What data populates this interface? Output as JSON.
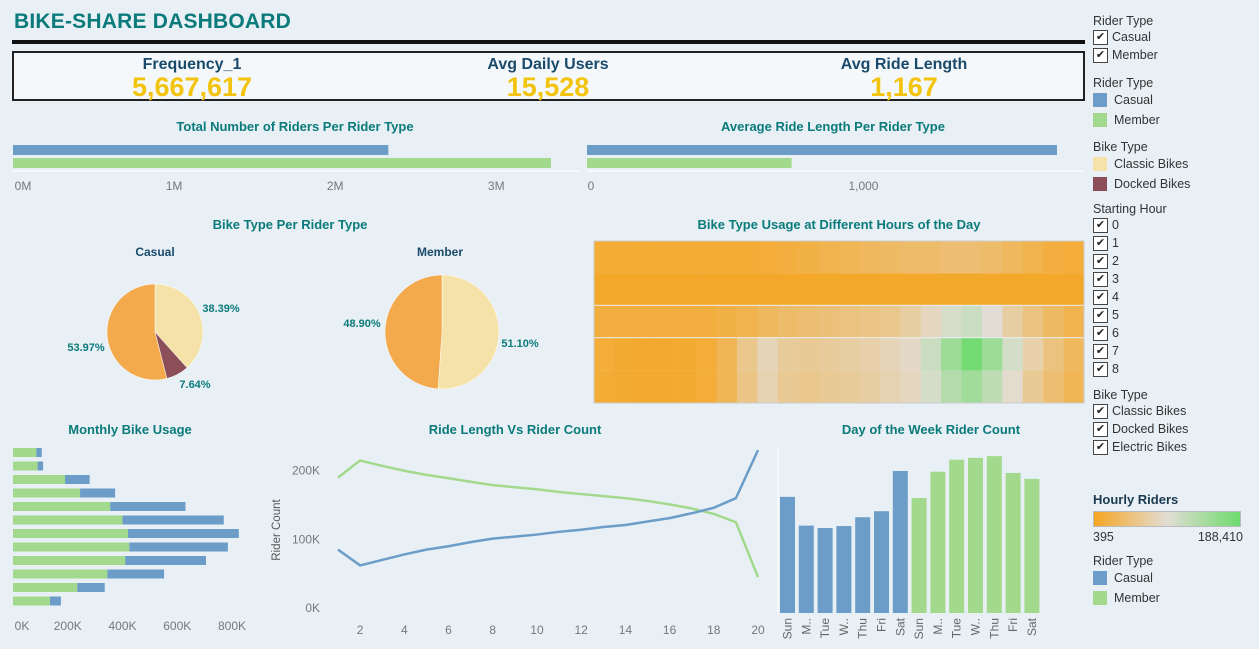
{
  "dashboard_title": "BIKE-SHARE DASHBOARD",
  "kpis": [
    {
      "label": "Frequency_1",
      "value": "5,667,617"
    },
    {
      "label": "Avg Daily Users",
      "value": "15,528"
    },
    {
      "label": "Avg Ride Length",
      "value": "1,167"
    }
  ],
  "colors": {
    "casual": "#6b9dc8",
    "member": "#a3d98c",
    "classic": "#f5e2a8",
    "docked": "#8c4f5a",
    "electric": "#f2aa4c",
    "title": "#0b7a7a",
    "kpi": "#f2c40e"
  },
  "charts": {
    "riders_per_type": {
      "title": "Total Number of Riders Per Rider Type",
      "ticks": [
        "0M",
        "1M",
        "2M",
        "3M"
      ]
    },
    "avg_ride_length": {
      "title": "Average Ride Length Per Rider Type",
      "ticks": [
        "0",
        "1,000"
      ]
    },
    "bike_type_per_rider": {
      "title": "Bike Type Per Rider Type",
      "casual_label": "Casual",
      "member_label": "Member"
    },
    "heatmap": {
      "title": "Bike Type Usage at Different Hours of the Day"
    },
    "monthly": {
      "title": "Monthly Bike Usage",
      "ticks": [
        "0K",
        "200K",
        "400K",
        "600K",
        "800K"
      ]
    },
    "ride_vs_count": {
      "title": "Ride Length Vs Rider Count",
      "ylabel": "Rider Count",
      "yticks": [
        "200K",
        "100K",
        "0K"
      ],
      "xticks": [
        "2",
        "4",
        "6",
        "8",
        "10",
        "12",
        "14",
        "16",
        "18",
        "20"
      ]
    },
    "dow": {
      "title": "Day of the Week Rider Count"
    }
  },
  "chart_data": [
    {
      "type": "bar",
      "title": "Total Number of Riders Per Rider Type",
      "categories": [
        "Casual",
        "Member"
      ],
      "values": [
        2330000,
        3340000
      ],
      "xlim": [
        0,
        3500000
      ]
    },
    {
      "type": "bar",
      "title": "Average Ride Length Per Rider Type",
      "categories": [
        "Casual",
        "Member"
      ],
      "values": [
        1700,
        740
      ],
      "xlim": [
        0,
        1800
      ]
    },
    {
      "type": "pie",
      "title": "Casual",
      "slices": [
        {
          "name": "Classic Bikes",
          "value": 38.39,
          "label": "38.39%"
        },
        {
          "name": "Docked Bikes",
          "value": 7.64,
          "label": "7.64%"
        },
        {
          "name": "Electric Bikes",
          "value": 53.97,
          "label": "53.97%"
        }
      ]
    },
    {
      "type": "pie",
      "title": "Member",
      "slices": [
        {
          "name": "Classic Bikes",
          "value": 51.1,
          "label": "51.10%"
        },
        {
          "name": "Electric Bikes",
          "value": 48.9,
          "label": "48.90%"
        }
      ]
    },
    {
      "type": "heatmap",
      "title": "Bike Type Usage at Different Hours of the Day",
      "value_range": [
        395,
        188410
      ],
      "rows": 5,
      "cols": 24,
      "values": [
        [
          0.05,
          0.05,
          0.05,
          0.05,
          0.05,
          0.05,
          0.05,
          0.05,
          0.06,
          0.08,
          0.1,
          0.12,
          0.14,
          0.16,
          0.18,
          0.2,
          0.2,
          0.22,
          0.22,
          0.2,
          0.16,
          0.12,
          0.08,
          0.06
        ],
        [
          0.02,
          0.02,
          0.02,
          0.02,
          0.02,
          0.02,
          0.02,
          0.02,
          0.02,
          0.02,
          0.02,
          0.02,
          0.02,
          0.02,
          0.02,
          0.02,
          0.02,
          0.02,
          0.02,
          0.02,
          0.02,
          0.02,
          0.02,
          0.02
        ],
        [
          0.08,
          0.08,
          0.08,
          0.08,
          0.08,
          0.08,
          0.1,
          0.12,
          0.16,
          0.2,
          0.22,
          0.24,
          0.26,
          0.28,
          0.3,
          0.36,
          0.44,
          0.55,
          0.6,
          0.5,
          0.36,
          0.26,
          0.18,
          0.12
        ],
        [
          0.06,
          0.04,
          0.03,
          0.03,
          0.04,
          0.06,
          0.14,
          0.3,
          0.42,
          0.34,
          0.32,
          0.34,
          0.36,
          0.38,
          0.42,
          0.46,
          0.6,
          0.8,
          0.98,
          0.8,
          0.56,
          0.38,
          0.26,
          0.16
        ],
        [
          0.05,
          0.04,
          0.03,
          0.03,
          0.04,
          0.06,
          0.14,
          0.28,
          0.4,
          0.32,
          0.3,
          0.32,
          0.34,
          0.36,
          0.4,
          0.44,
          0.56,
          0.7,
          0.78,
          0.66,
          0.48,
          0.32,
          0.22,
          0.14
        ]
      ]
    },
    {
      "type": "bar",
      "title": "Monthly Bike Usage",
      "series": [
        {
          "name": "Member",
          "values": [
            85000,
            90000,
            190000,
            245000,
            355000,
            400000,
            420000,
            425000,
            410000,
            345000,
            235000,
            135000
          ]
        },
        {
          "name": "Casual",
          "values": [
            20000,
            20000,
            90000,
            128000,
            275000,
            370000,
            405000,
            360000,
            295000,
            207000,
            100000,
            40000
          ]
        }
      ],
      "xlim": [
        0,
        860000
      ]
    },
    {
      "type": "line",
      "title": "Ride Length Vs Rider Count",
      "ylabel": "Rider Count",
      "x": [
        1,
        2,
        3,
        4,
        5,
        6,
        7,
        8,
        9,
        10,
        11,
        12,
        13,
        14,
        15,
        16,
        17,
        18,
        19,
        20
      ],
      "ylim": [
        0,
        260000
      ],
      "series": [
        {
          "name": "Member",
          "values": [
            190000,
            215000,
            207000,
            200000,
            194000,
            189000,
            184000,
            179000,
            176000,
            173000,
            169000,
            166000,
            163000,
            160000,
            156000,
            151000,
            145000,
            137000,
            125000,
            45000
          ]
        },
        {
          "name": "Casual",
          "values": [
            85000,
            62000,
            70000,
            78000,
            85000,
            90000,
            96000,
            101000,
            104000,
            107000,
            111000,
            114000,
            118000,
            121000,
            126000,
            131000,
            138000,
            146000,
            160000,
            230000
          ]
        }
      ]
    },
    {
      "type": "bar",
      "title": "Day of the Week Rider Count",
      "categories": [
        "Sun",
        "Mon",
        "Tue",
        "Wed",
        "Thu",
        "Fri",
        "Sat",
        "Sun",
        "Mon",
        "Tue",
        "Wed",
        "Thu",
        "Fri",
        "Sat"
      ],
      "category_labels": [
        "Sun",
        "M..",
        "Tue",
        "W..",
        "Thu",
        "Fri",
        "Sat",
        "Sun",
        "M..",
        "Tue",
        "W..",
        "Thu",
        "Fri",
        "Sat"
      ],
      "series": [
        {
          "name": "Casual",
          "values": [
            485000,
            365000,
            355000,
            363000,
            400000,
            425000,
            593000
          ]
        },
        {
          "name": "Member",
          "values": [
            480000,
            590000,
            640000,
            648000,
            655000,
            585000,
            560000
          ]
        }
      ],
      "ylim": [
        0,
        700000
      ]
    }
  ],
  "legend": {
    "rider_type_filter": {
      "title": "Rider Type",
      "items": [
        "Casual",
        "Member"
      ]
    },
    "rider_type_color": {
      "title": "Rider Type",
      "items": [
        "Casual",
        "Member"
      ]
    },
    "bike_type_color": {
      "title": "Bike Type",
      "items": [
        "Classic Bikes",
        "Docked Bikes"
      ]
    },
    "starting_hour": {
      "title": "Starting Hour",
      "items": [
        "0",
        "1",
        "2",
        "3",
        "4",
        "5",
        "6",
        "7",
        "8"
      ]
    },
    "bike_type_filter": {
      "title": "Bike Type",
      "items": [
        "Classic Bikes",
        "Docked Bikes",
        "Electric Bikes"
      ]
    },
    "hourly_riders": {
      "title": "Hourly Riders",
      "min": "395",
      "max": "188,410"
    },
    "rider_type_color2": {
      "title": "Rider Type",
      "items": [
        "Casual",
        "Member"
      ]
    }
  }
}
